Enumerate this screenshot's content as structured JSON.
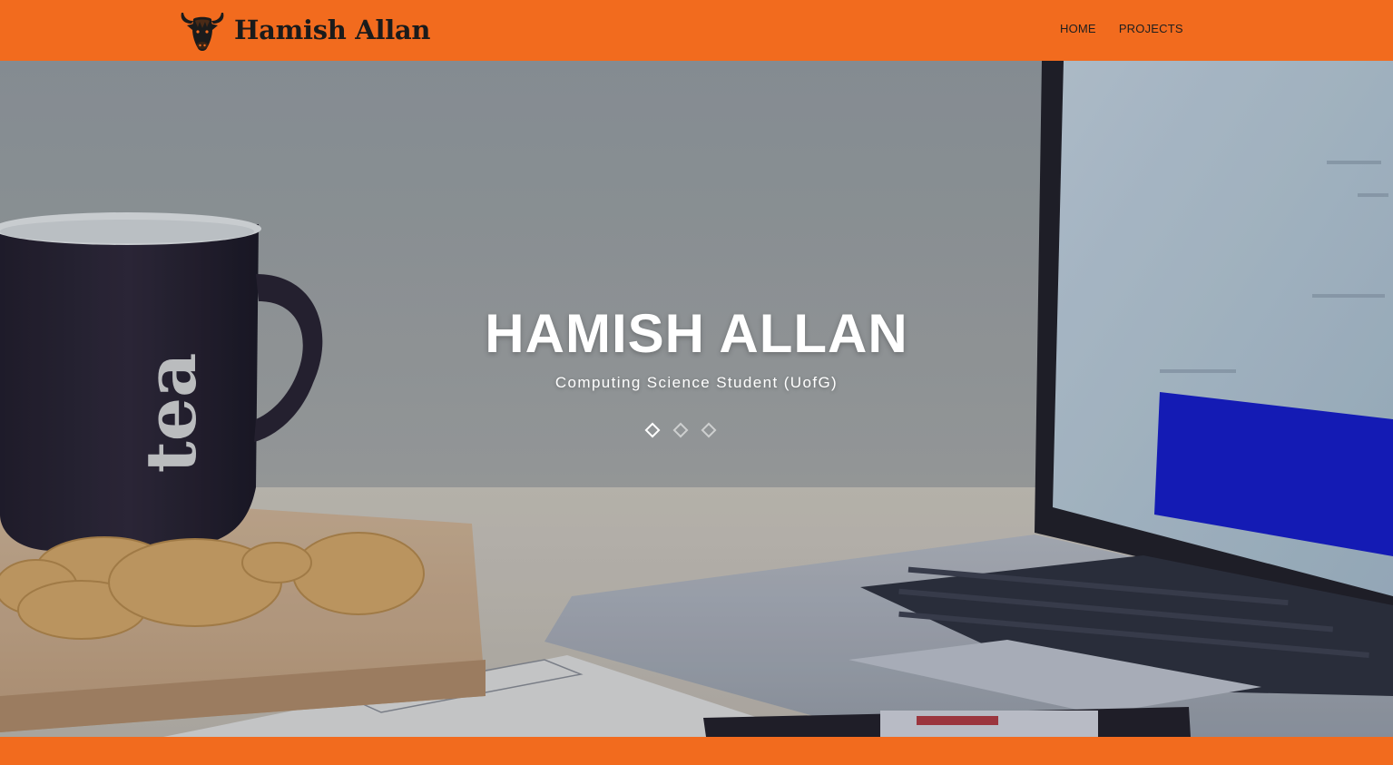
{
  "header": {
    "brand_name": "Hamish Allan",
    "brand_logo_icon": "highland-cow-logo-icon",
    "background_color": "#f26b1e",
    "nav": [
      {
        "label": "HOME"
      },
      {
        "label": "PROJECTS"
      }
    ]
  },
  "hero": {
    "title": "HAMISH ALLAN",
    "subtitle": "Computing Science Student (UofG)",
    "carousel": {
      "slide_count": 3,
      "active_index": 0
    }
  },
  "footer": {
    "background_color": "#f26b1e"
  }
}
